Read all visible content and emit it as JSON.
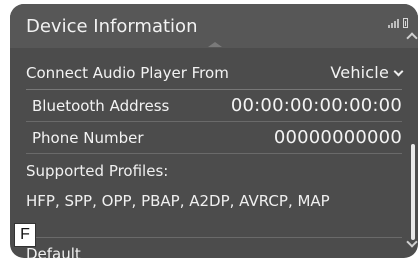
{
  "header": {
    "title": "Device Information"
  },
  "connect_audio": {
    "label": "Connect Audio Player From",
    "value": "Vehicle"
  },
  "bluetooth_address": {
    "label": "Bluetooth Address",
    "value": "00:00:00:00:00:00"
  },
  "phone_number": {
    "label": "Phone Number",
    "value": "00000000000"
  },
  "profiles": {
    "label": "Supported Profiles:",
    "value": "HFP, SPP, OPP, PBAP, A2DP, AVRCP, MAP"
  },
  "default_button": {
    "label": "Default"
  },
  "callout": {
    "letter": "F"
  },
  "icons": [
    "signal-icon",
    "battery-icon",
    "chevron-down-icon",
    "scroll-up-icon",
    "scroll-down-icon"
  ]
}
